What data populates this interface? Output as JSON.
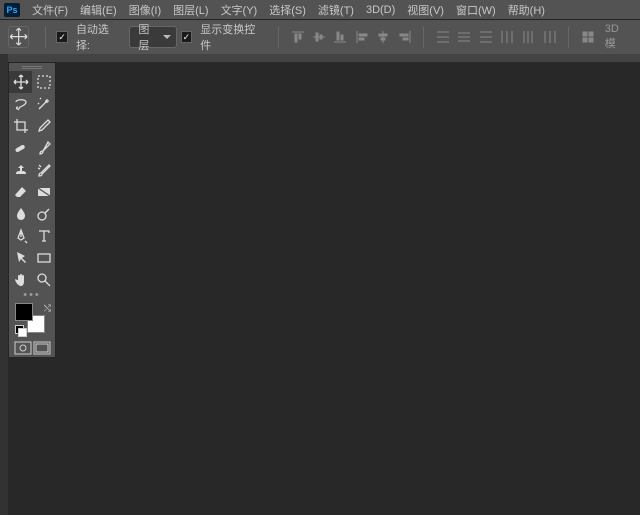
{
  "app": {
    "logo": "Ps"
  },
  "menu": {
    "file": "文件(F)",
    "edit": "编辑(E)",
    "image": "图像(I)",
    "layer": "图层(L)",
    "type": "文字(Y)",
    "select": "选择(S)",
    "filter": "滤镜(T)",
    "threed": "3D(D)",
    "view": "视图(V)",
    "window": "窗口(W)",
    "help": "帮助(H)"
  },
  "options": {
    "auto_select_label": "自动选择:",
    "auto_select_value": "图层",
    "show_transform_label": "显示变换控件",
    "threed_mode": "3D 模"
  },
  "swatches": {
    "fg": "#000000",
    "bg": "#ffffff"
  }
}
